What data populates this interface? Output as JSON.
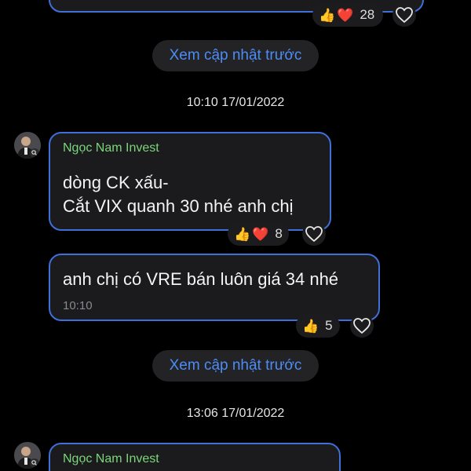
{
  "top_reactions": {
    "count": "28"
  },
  "load_more_1": {
    "label": "Xem cập nhật trước"
  },
  "timestamp_1": {
    "text": "10:10 17/01/2022"
  },
  "message_1": {
    "sender": "Ngọc Nam Invest",
    "line1": "dòng CK xấu-",
    "line2": "Cắt VIX quanh 30 nhé anh chị",
    "reaction_count": "8"
  },
  "message_2": {
    "text": "anh chị có VRE bán luôn giá 34 nhé",
    "time": "10:10",
    "reaction_count": "5"
  },
  "load_more_2": {
    "label": "Xem cập nhật trước"
  },
  "timestamp_2": {
    "text": "13:06 17/01/2022"
  },
  "message_3": {
    "sender": "Ngọc Nam Invest"
  },
  "icons": {
    "like": "thumbs-up-icon",
    "love": "red-heart-icon",
    "react": "heart-outline-icon"
  },
  "colors": {
    "background": "#000000",
    "bubble_bg": "#1b1b1d",
    "bubble_border": "#3f6fd9",
    "sender_name": "#7bd67b",
    "link_blue": "#4d8cf5"
  }
}
